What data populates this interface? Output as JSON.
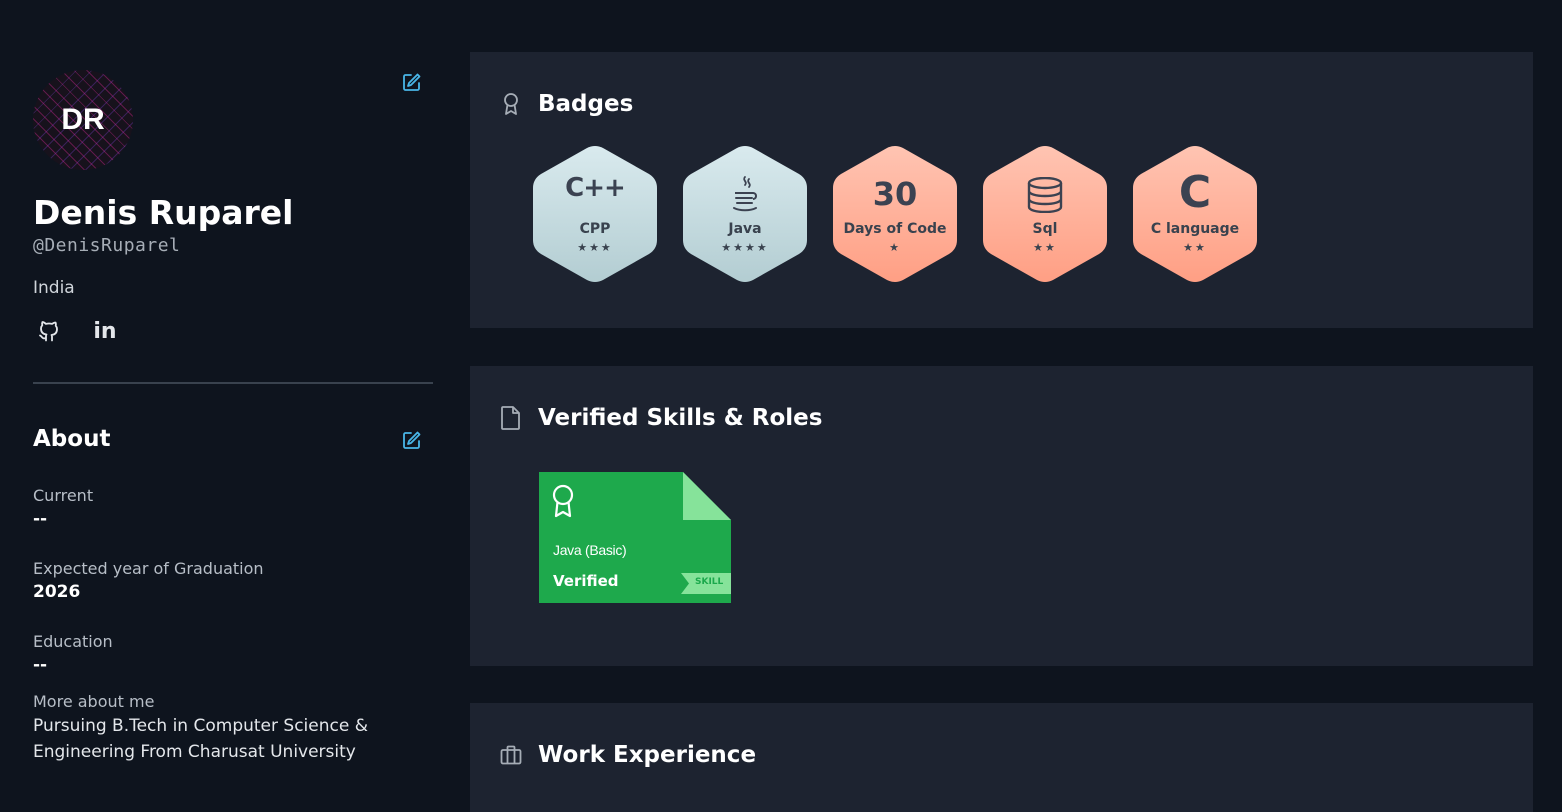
{
  "profile": {
    "initials": "DR",
    "name": "Denis Ruparel",
    "handle": "@DenisRuparel",
    "country": "India",
    "social_icons": [
      "github-icon",
      "linkedin-icon"
    ],
    "linkedin_glyph": "in"
  },
  "about": {
    "title": "About",
    "current_label": "Current",
    "current_value": "--",
    "graduation_label": "Expected year of Graduation",
    "graduation_value": "2026",
    "education_label": "Education",
    "education_value": "--",
    "more_label": "More about me",
    "more_value": "Pursuing B.Tech in Computer Science & Engineering From Charusat University"
  },
  "badges": {
    "title": "Badges",
    "items": [
      {
        "name": "CPP",
        "icon": "C++",
        "stars": 3,
        "stars_text": "★★★",
        "color": "#c8dde3"
      },
      {
        "name": "Java",
        "icon": "java-icon",
        "stars": 4,
        "stars_text": "★★★★",
        "color": "#c8dde3"
      },
      {
        "name": "Days of Code",
        "icon": "30",
        "stars": 1,
        "stars_text": "★",
        "color": "#ffb29b"
      },
      {
        "name": "Sql",
        "icon": "database-icon",
        "stars": 2,
        "stars_text": "★★",
        "color": "#ffb29b"
      },
      {
        "name": "C language",
        "icon": "C",
        "stars": 2,
        "stars_text": "★★",
        "color": "#ffb29b"
      }
    ]
  },
  "skills": {
    "title": "Verified Skills & Roles",
    "certificate": {
      "title": "Java (Basic)",
      "status": "Verified",
      "tag": "SKILL"
    }
  },
  "work": {
    "title": "Work Experience"
  },
  "colors": {
    "background": "#0e141e",
    "card": "#1d2330",
    "accent": "#49b6e8",
    "cert_green": "#1ba94c"
  }
}
